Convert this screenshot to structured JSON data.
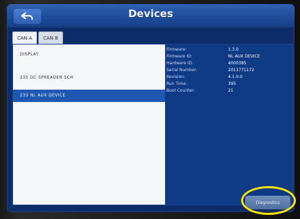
{
  "header": {
    "title": "Devices"
  },
  "tabs": [
    {
      "label": "CAN A"
    },
    {
      "label": "CAN B"
    }
  ],
  "device_list": [
    {
      "label": "DISPLAY"
    },
    {
      "label": "235 DC SPREADER SCH"
    },
    {
      "label": "233 NL AUX DEVICE"
    }
  ],
  "details": {
    "rows": [
      {
        "label": "Firmware:",
        "value": "1.3.0"
      },
      {
        "label": "Firmware ID:",
        "value": "NL AUX DEVICE"
      },
      {
        "label": "Hardware ID:",
        "value": "4000385"
      },
      {
        "label": "Serial Number:",
        "value": "2011771172"
      },
      {
        "label": "Revision:",
        "value": "4.1.0.0"
      },
      {
        "label": "Run Time:",
        "value": "395"
      },
      {
        "label": "Boot Counter:",
        "value": "21"
      }
    ]
  },
  "footer": {
    "diagnostics_label": "Diagnostics"
  },
  "colors": {
    "accent": "#1f58b2",
    "highlight": "#ffe600",
    "screen_bg": "#0c2d6a"
  },
  "icons": {
    "back": "back-arrow-icon"
  }
}
